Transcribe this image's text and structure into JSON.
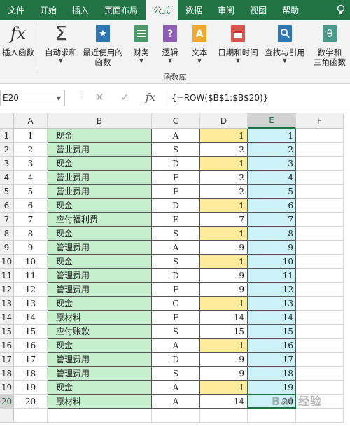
{
  "tabs": [
    {
      "label": "文件",
      "active": false
    },
    {
      "label": "开始",
      "active": false
    },
    {
      "label": "插入",
      "active": false
    },
    {
      "label": "页面布局",
      "active": false
    },
    {
      "label": "公式",
      "active": true
    },
    {
      "label": "数据",
      "active": false
    },
    {
      "label": "审阅",
      "active": false
    },
    {
      "label": "视图",
      "active": false
    },
    {
      "label": "帮助",
      "active": false
    }
  ],
  "ribbon": {
    "insert_function": "插入函数",
    "autosum": "自动求和",
    "recent_line1": "最近使用的",
    "recent_line2": "函数",
    "financial": "财务",
    "logical": "逻辑",
    "text": "文本",
    "datetime": "日期和时间",
    "lookup": "查找与引用",
    "math_line1": "数学和",
    "math_line2": "三角函数",
    "group_label": "函数库"
  },
  "formula_bar": {
    "name_box": "E20",
    "fx": "fx",
    "formula": "{=ROW($B$1:$B$20)}"
  },
  "columns": [
    "A",
    "B",
    "C",
    "D",
    "E",
    "F"
  ],
  "selected_column": "E",
  "selected_row": 20,
  "rows": [
    {
      "n": 1,
      "a": "1",
      "b": "现金",
      "c": "A",
      "d": 1,
      "e": 1,
      "dh": true
    },
    {
      "n": 2,
      "a": "2",
      "b": "营业费用",
      "c": "S",
      "d": 2,
      "e": 2,
      "dh": false
    },
    {
      "n": 3,
      "a": "3",
      "b": "现金",
      "c": "D",
      "d": 1,
      "e": 3,
      "dh": true
    },
    {
      "n": 4,
      "a": "4",
      "b": "营业费用",
      "c": "F",
      "d": 2,
      "e": 4,
      "dh": false
    },
    {
      "n": 5,
      "a": "5",
      "b": "营业费用",
      "c": "F",
      "d": 2,
      "e": 5,
      "dh": false
    },
    {
      "n": 6,
      "a": "6",
      "b": "现金",
      "c": "D",
      "d": 1,
      "e": 6,
      "dh": true
    },
    {
      "n": 7,
      "a": "7",
      "b": "应付福利费",
      "c": "E",
      "d": 7,
      "e": 7,
      "dh": false
    },
    {
      "n": 8,
      "a": "8",
      "b": "现金",
      "c": "S",
      "d": 1,
      "e": 8,
      "dh": true
    },
    {
      "n": 9,
      "a": "9",
      "b": "管理费用",
      "c": "A",
      "d": 9,
      "e": 9,
      "dh": false
    },
    {
      "n": 10,
      "a": "10",
      "b": "现金",
      "c": "S",
      "d": 1,
      "e": 10,
      "dh": true
    },
    {
      "n": 11,
      "a": "11",
      "b": "管理费用",
      "c": "D",
      "d": 9,
      "e": 11,
      "dh": false
    },
    {
      "n": 12,
      "a": "12",
      "b": "管理费用",
      "c": "F",
      "d": 9,
      "e": 12,
      "dh": false
    },
    {
      "n": 13,
      "a": "13",
      "b": "现金",
      "c": "G",
      "d": 1,
      "e": 13,
      "dh": true
    },
    {
      "n": 14,
      "a": "14",
      "b": "原材料",
      "c": "F",
      "d": 14,
      "e": 14,
      "dh": false
    },
    {
      "n": 15,
      "a": "15",
      "b": "应付账款",
      "c": "S",
      "d": 15,
      "e": 15,
      "dh": false
    },
    {
      "n": 16,
      "a": "16",
      "b": "现金",
      "c": "A",
      "d": 1,
      "e": 16,
      "dh": true
    },
    {
      "n": 17,
      "a": "17",
      "b": "管理费用",
      "c": "D",
      "d": 9,
      "e": 17,
      "dh": false
    },
    {
      "n": 18,
      "a": "18",
      "b": "管理费用",
      "c": "S",
      "d": 9,
      "e": 18,
      "dh": false
    },
    {
      "n": 19,
      "a": "19",
      "b": "现金",
      "c": "A",
      "d": 1,
      "e": 19,
      "dh": true
    },
    {
      "n": 20,
      "a": "20",
      "b": "原材料",
      "c": "A",
      "d": 14,
      "e": 20,
      "dh": false
    }
  ],
  "colors": {
    "excel_green": "#217346",
    "b_fill": "#c6efce",
    "d_highlight": "#ffeb9c",
    "e_fill": "#ccf1f7"
  },
  "watermark": "Bai 经验"
}
